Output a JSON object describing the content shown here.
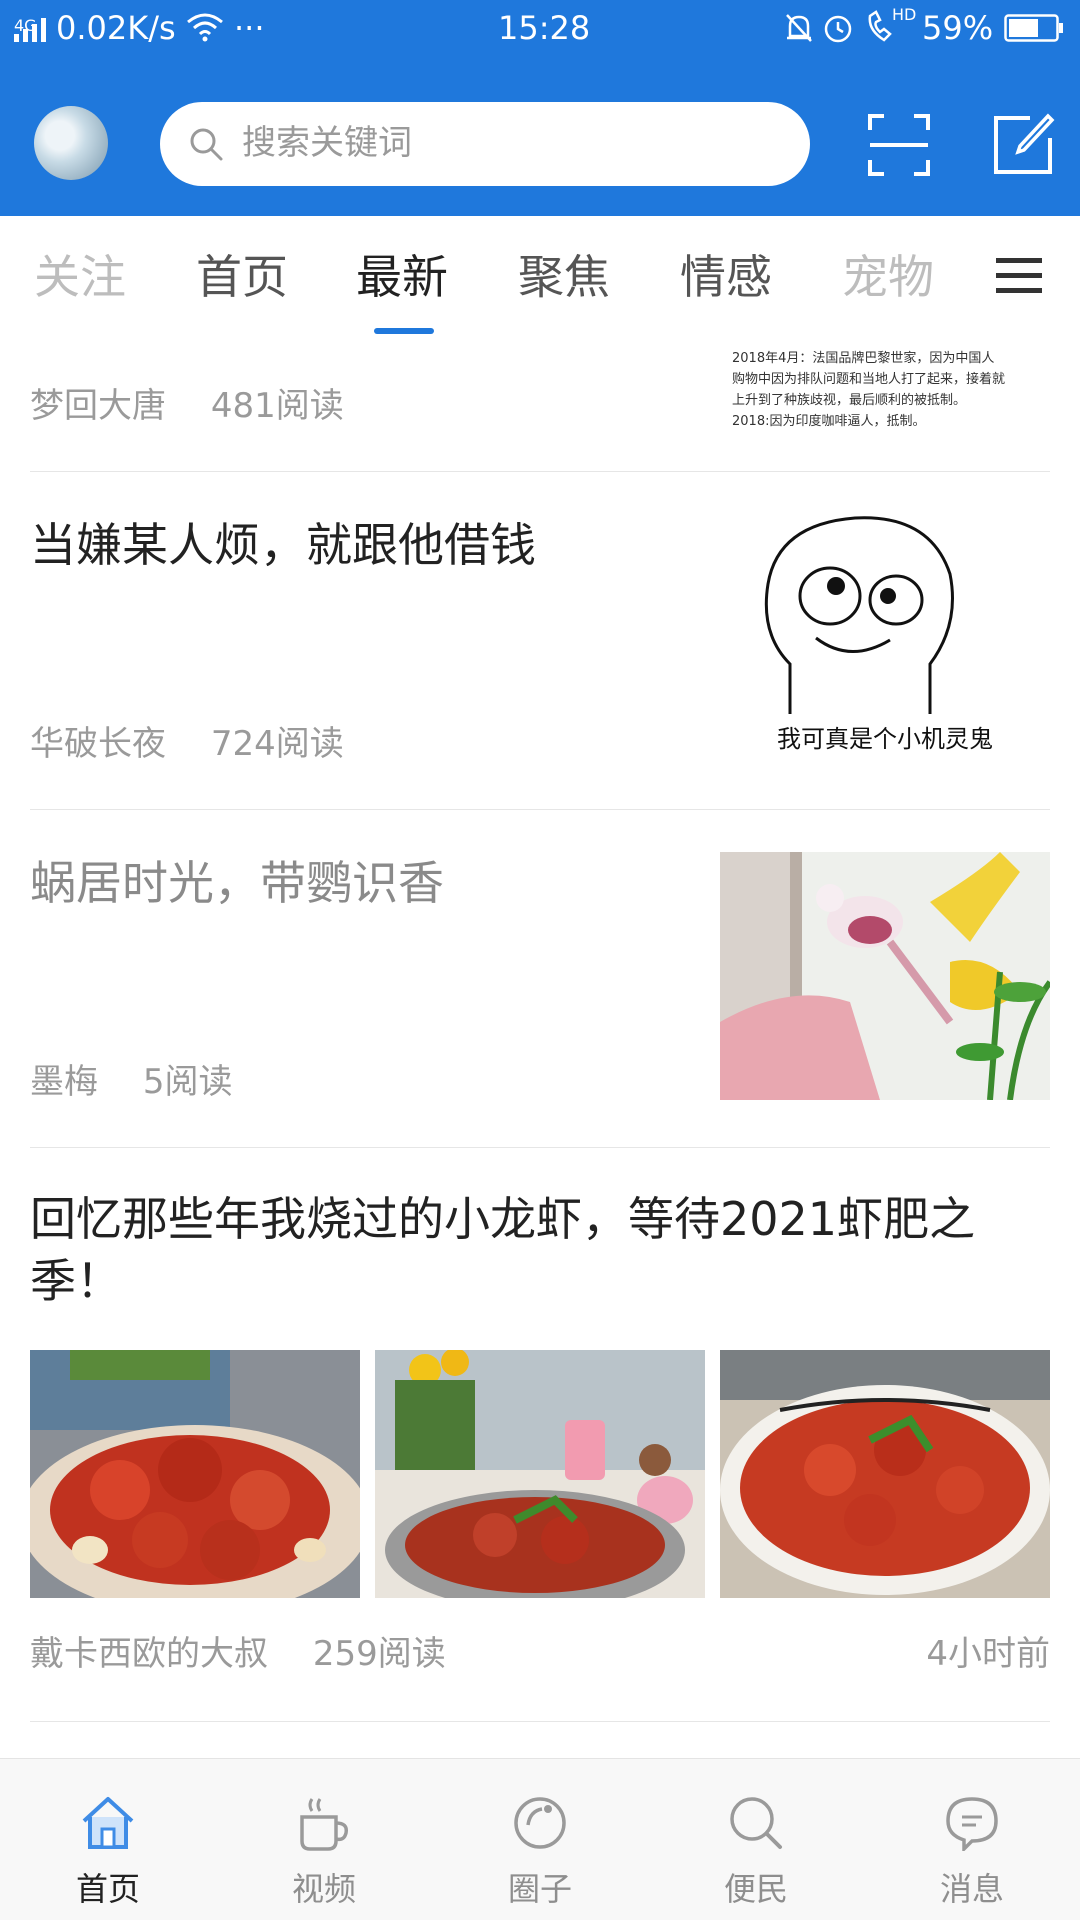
{
  "status_bar": {
    "network": "4G",
    "speed": "0.02K/s",
    "dots": "···",
    "time": "15:28",
    "hd": "HD",
    "battery": "59%"
  },
  "header": {
    "search_placeholder": "搜索关键词",
    "icons": [
      "scan-icon",
      "edit-icon"
    ],
    "accent_color": "#1f78dc"
  },
  "tabs": {
    "items": [
      {
        "label": "关注"
      },
      {
        "label": "首页"
      },
      {
        "label": "最新"
      },
      {
        "label": "聚焦"
      },
      {
        "label": "情感"
      },
      {
        "label": "宠物"
      }
    ],
    "active": "最新"
  },
  "feed": {
    "items": [
      {
        "author": "梦回大唐",
        "reads": "481阅读",
        "image_text": [
          "2018年4月：法国品牌巴黎世家，因为中国人",
          "购物中因为排队问题和当地人打了起来，接着就",
          "上升到了种族歧视，最后顺利的被抵制。",
          "2018:因为印度咖啡逼人，抵制。"
        ]
      },
      {
        "title": "当嫌某人烦，就跟他借钱",
        "author": "华破长夜",
        "reads": "724阅读",
        "image_caption": "我可真是个小机灵鬼"
      },
      {
        "title": "蜗居时光，带鹦识香",
        "author": "墨梅",
        "reads": "5阅读"
      },
      {
        "title": "回忆那些年我烧过的小龙虾，等待2021虾肥之季！",
        "author": "戴卡西欧的大叔",
        "reads": "259阅读",
        "time": "4小时前"
      }
    ]
  },
  "bottom_nav": {
    "items": [
      {
        "label": "首页",
        "icon": "home-icon"
      },
      {
        "label": "视频",
        "icon": "cup-icon"
      },
      {
        "label": "圈子",
        "icon": "circle-icon"
      },
      {
        "label": "便民",
        "icon": "search-icon"
      },
      {
        "label": "消息",
        "icon": "message-icon"
      }
    ],
    "active": "首页"
  }
}
